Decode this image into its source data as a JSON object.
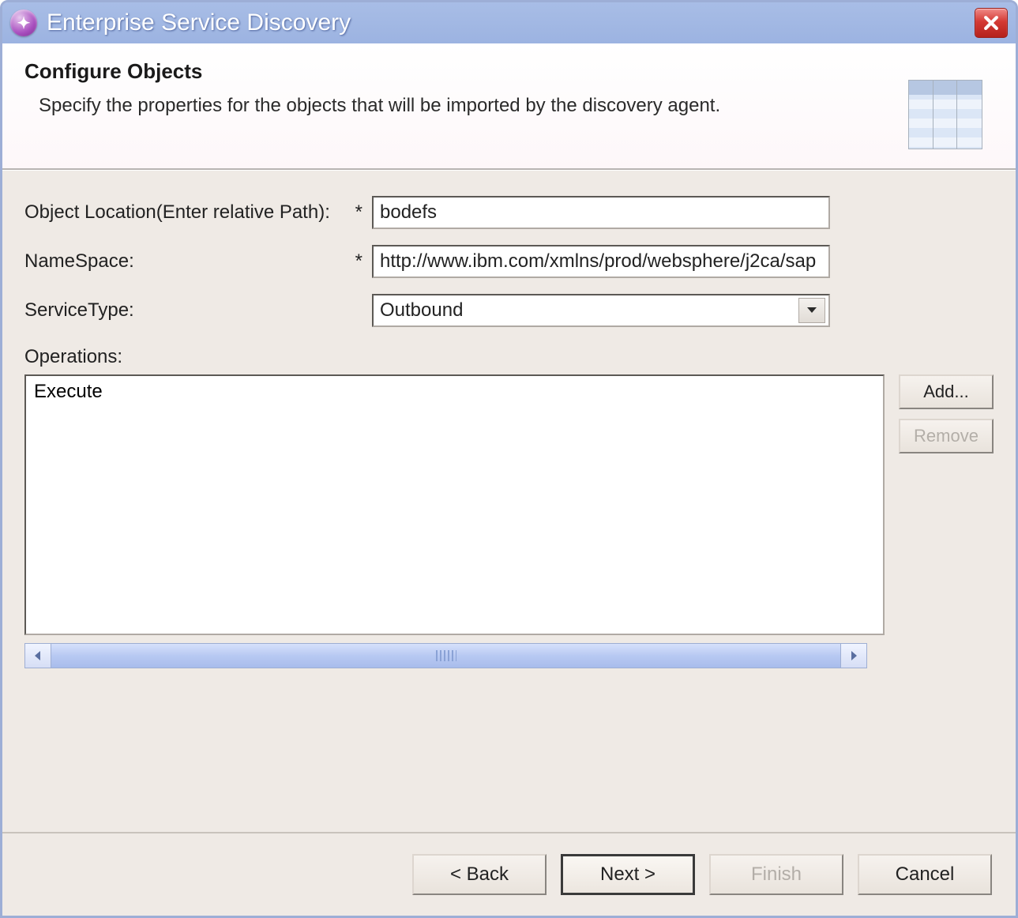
{
  "window": {
    "title": "Enterprise Service Discovery"
  },
  "header": {
    "title": "Configure Objects",
    "description": "Specify the properties for the objects that will be imported by the discovery agent."
  },
  "form": {
    "object_location": {
      "label": "Object Location(Enter relative Path):",
      "required_mark": "*",
      "value": "bodefs"
    },
    "namespace": {
      "label": "NameSpace:",
      "required_mark": "*",
      "value": "http://www.ibm.com/xmlns/prod/websphere/j2ca/sap"
    },
    "service_type": {
      "label": "ServiceType:",
      "value": "Outbound"
    },
    "operations": {
      "label": "Operations:",
      "items": [
        "Execute"
      ],
      "add_label": "Add...",
      "remove_label": "Remove",
      "remove_disabled": true
    }
  },
  "footer": {
    "back": "< Back",
    "next": "Next >",
    "finish": "Finish",
    "finish_disabled": true,
    "cancel": "Cancel"
  }
}
